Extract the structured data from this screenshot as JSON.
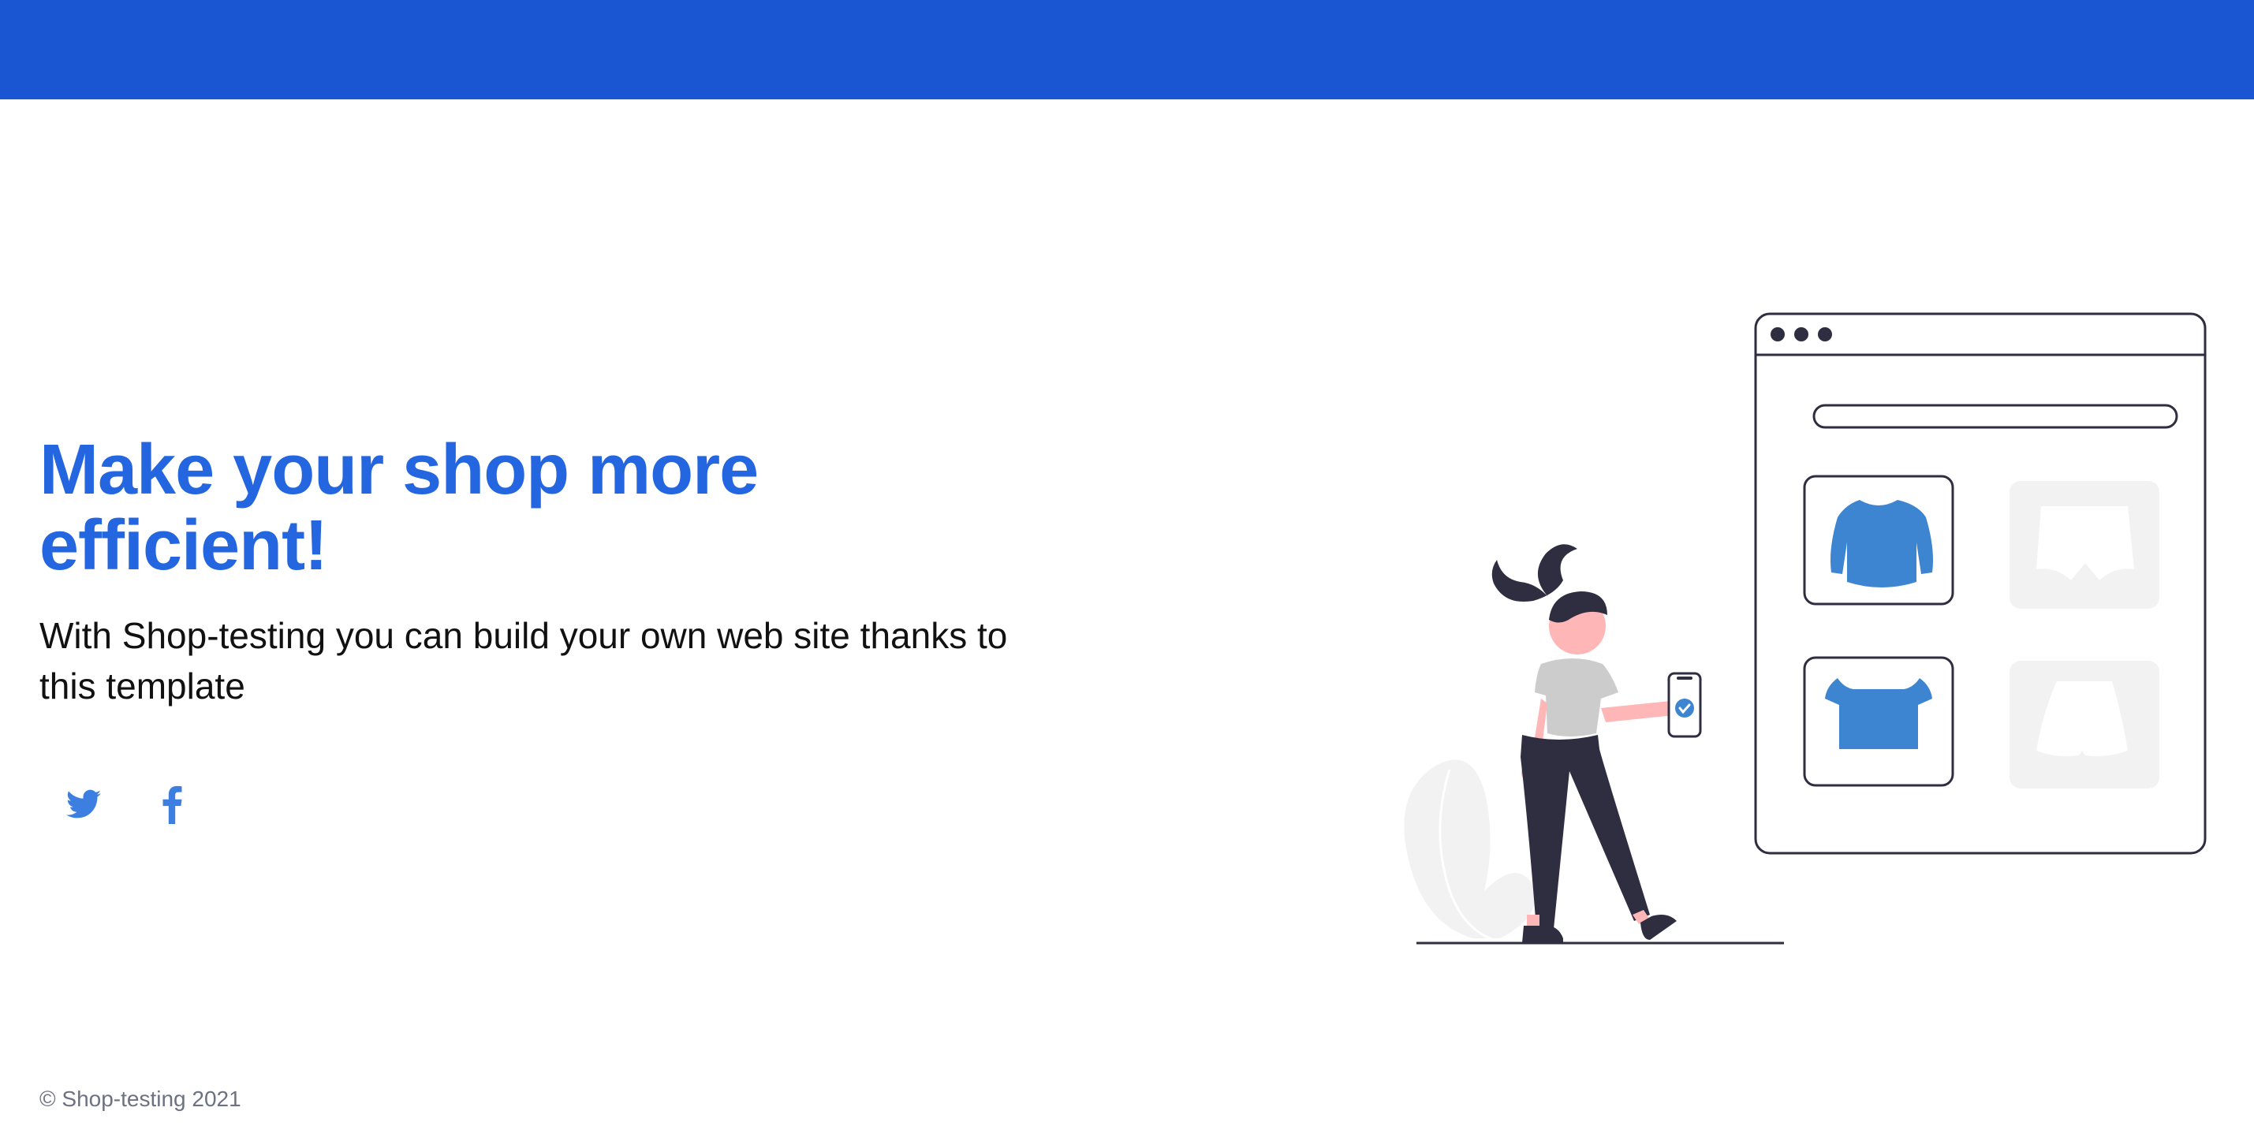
{
  "hero": {
    "title": "Make your shop more efficient!",
    "subtitle": "With Shop-testing you can build your own web site thanks to this template"
  },
  "social": {
    "twitter_icon": "twitter-icon",
    "facebook_icon": "facebook-icon"
  },
  "footer": {
    "copyright": "© Shop-testing 2021"
  },
  "colors": {
    "topbar": "#1a56d1",
    "accent": "#2466e0",
    "illustration_blue": "#3d84d1",
    "dark": "#2f2e41"
  }
}
